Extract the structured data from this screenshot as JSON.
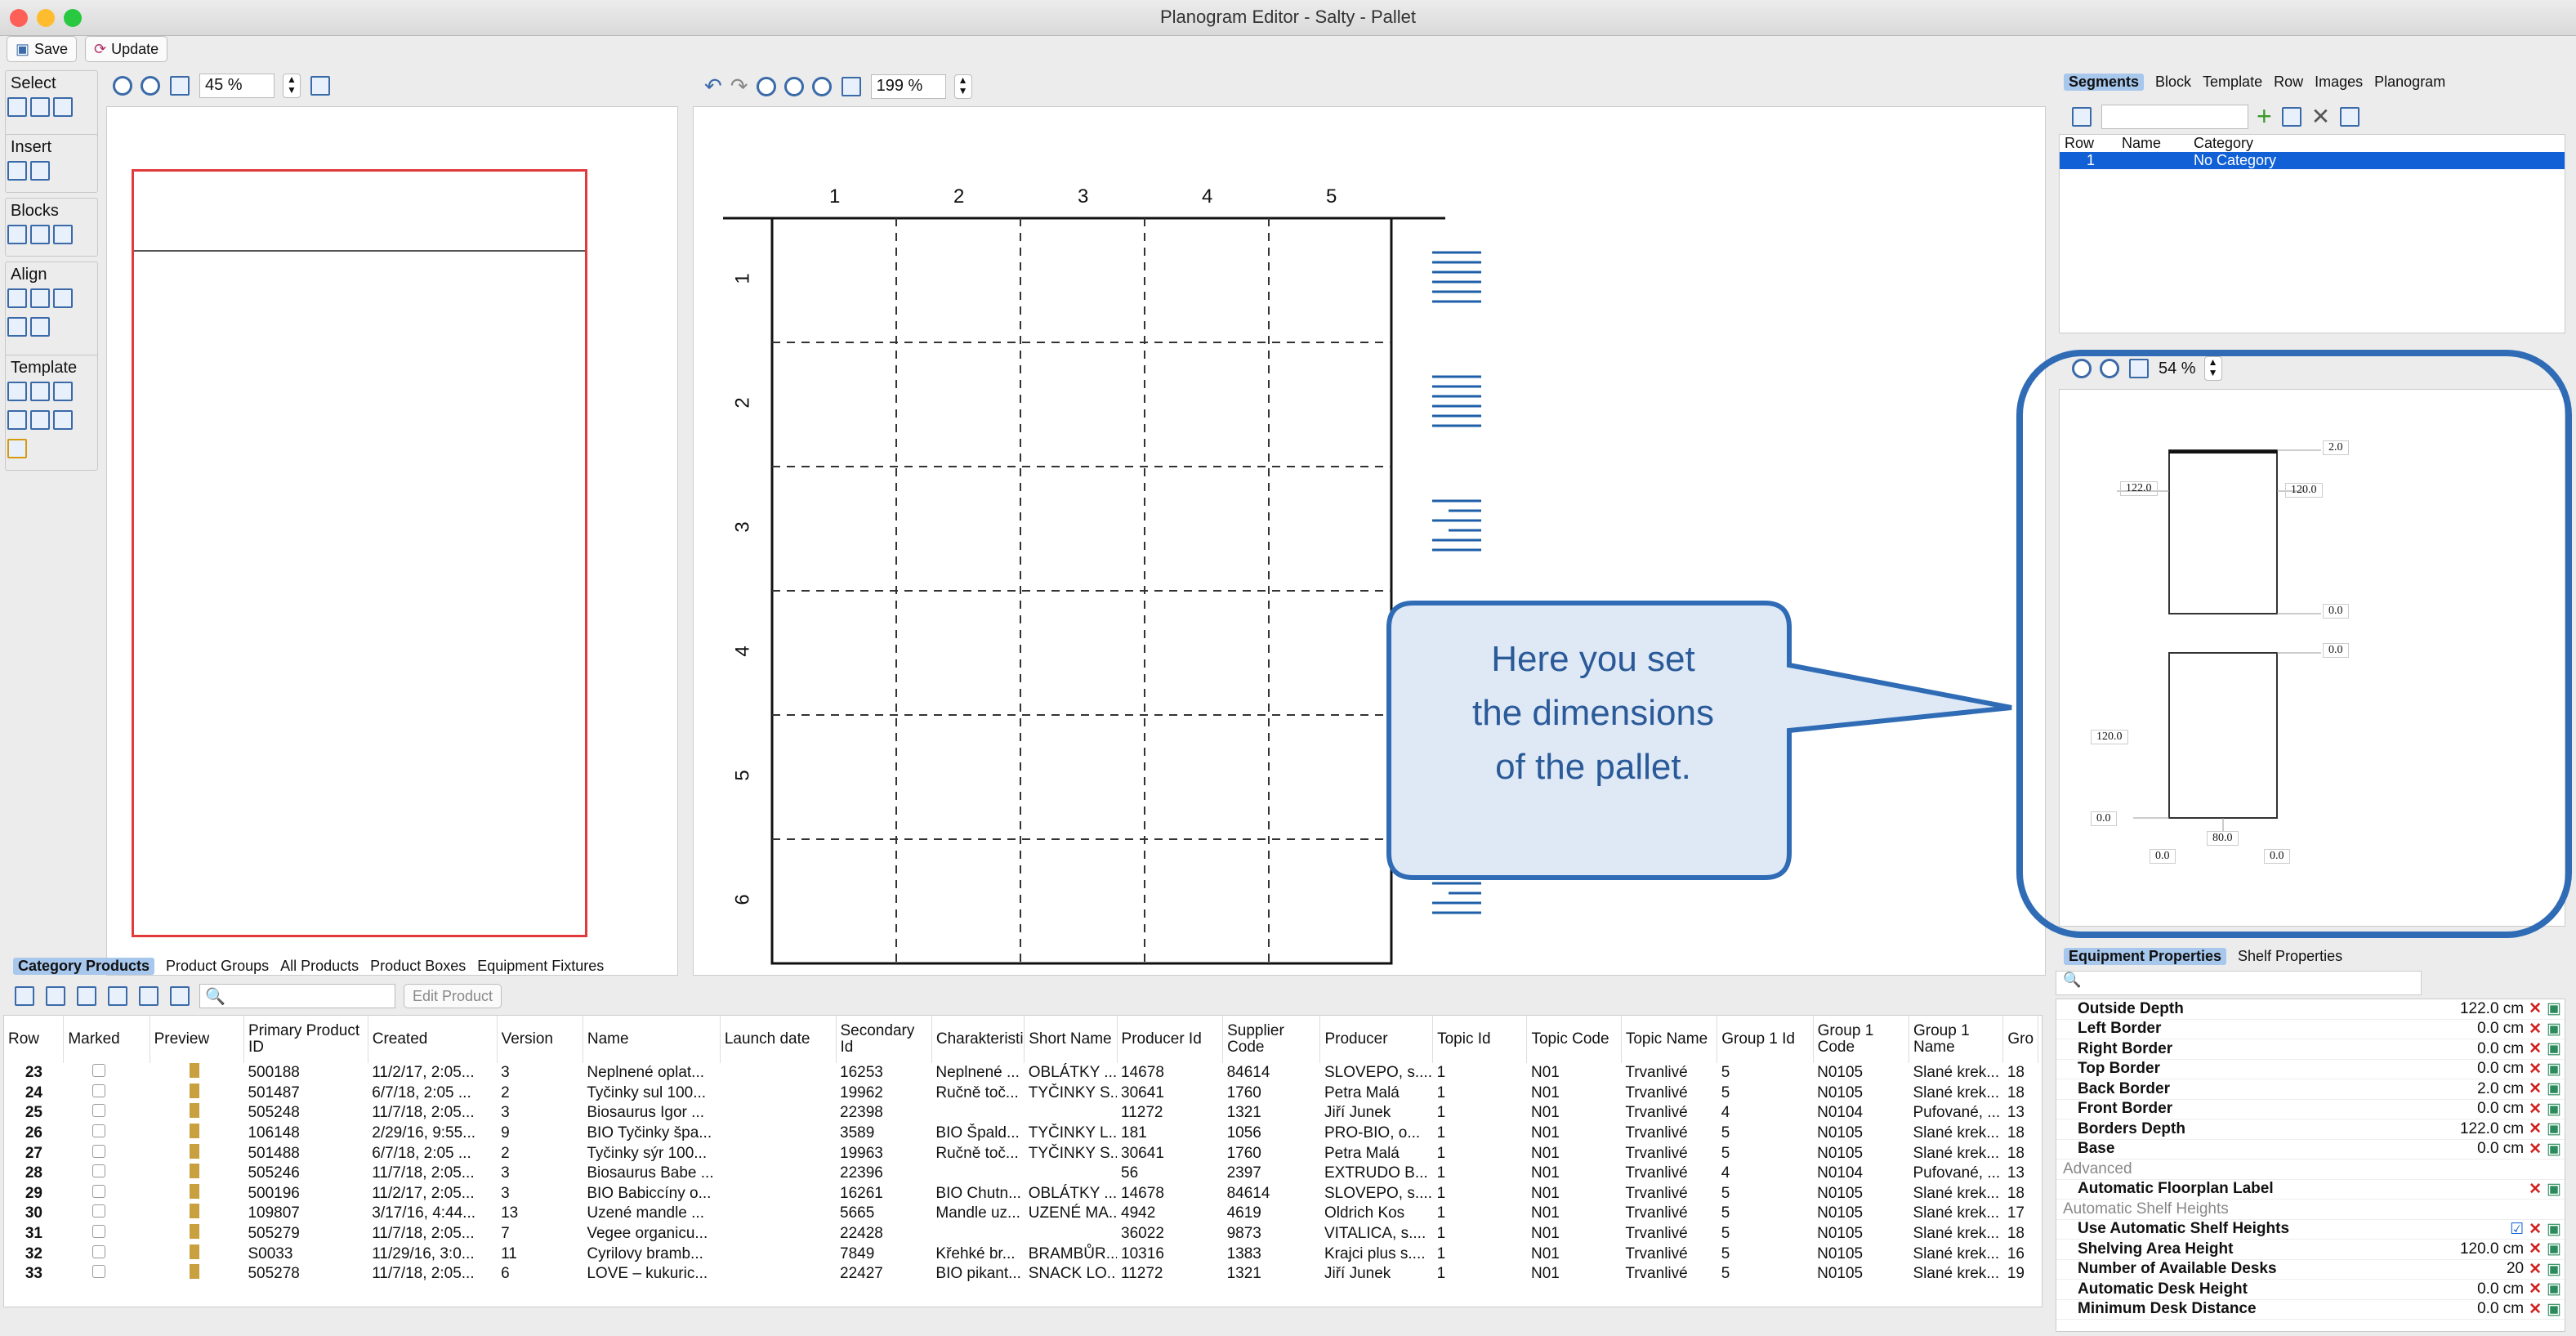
{
  "window": {
    "title": "Planogram Editor - Salty - Pallet"
  },
  "toolbar": {
    "save": "Save",
    "update": "Update"
  },
  "left": {
    "zoom": "45 %",
    "groups": {
      "select": "Select",
      "insert": "Insert",
      "blocks": "Blocks",
      "align": "Align",
      "template": "Template"
    }
  },
  "center": {
    "zoom": "199 %",
    "columns": [
      "1",
      "2",
      "3",
      "4",
      "5"
    ],
    "rows": [
      "1",
      "2",
      "3",
      "4",
      "5",
      "6"
    ]
  },
  "callout": {
    "line1": "Here you set",
    "line2": "the dimensions",
    "line3": "of the pallet."
  },
  "right": {
    "tabs": [
      "Segments",
      "Block",
      "Template",
      "Row",
      "Images",
      "Planogram"
    ],
    "seg_headers": [
      "Row",
      "Name",
      "Category"
    ],
    "seg_row": [
      "1",
      "",
      "No Category"
    ],
    "preview_zoom": "54 %",
    "dims": {
      "top": "2.0",
      "left_height": "122.0",
      "right_height": "120.0",
      "zero_a": "0.0",
      "zero_b": "0.0",
      "lower_height": "120.0",
      "bottom_left": "0.0",
      "width": "80.0",
      "bottom_a": "0.0",
      "bottom_b": "0.0"
    },
    "prop_tabs": [
      "Equipment Properties",
      "Shelf Properties"
    ],
    "props": [
      {
        "label": "Outside Depth",
        "value": "122.0 cm"
      },
      {
        "label": "Left Border",
        "value": "0.0 cm"
      },
      {
        "label": "Right Border",
        "value": "0.0 cm"
      },
      {
        "label": "Top Border",
        "value": "0.0 cm"
      },
      {
        "label": "Back Border",
        "value": "2.0 cm"
      },
      {
        "label": "Front Border",
        "value": "0.0 cm"
      },
      {
        "label": "Borders Depth",
        "value": "122.0 cm"
      },
      {
        "label": "Base",
        "value": "0.0 cm"
      }
    ],
    "advanced": "Advanced",
    "auto_floor": "Automatic Floorplan Label",
    "auto_shelf": "Automatic Shelf Heights",
    "props2": [
      {
        "label": "Use Automatic Shelf Heights",
        "value": "☑"
      },
      {
        "label": "Shelving Area Height",
        "value": "120.0 cm"
      },
      {
        "label": "Number of Available Desks",
        "value": "20"
      },
      {
        "label": "Automatic Desk Height",
        "value": "0.0 cm"
      },
      {
        "label": "Minimum Desk Distance",
        "value": "0.0 cm"
      }
    ]
  },
  "bottom": {
    "tabs": [
      "Category Products",
      "Product Groups",
      "All Products",
      "Product Boxes",
      "Equipment Fixtures"
    ],
    "edit_product": "Edit Product",
    "headers": [
      "Row",
      "Marked",
      "Preview",
      "Primary Product ID",
      "Created",
      "Version",
      "Name",
      "Launch date",
      "Secondary Id",
      "Charakteristika",
      "Short Name",
      "Producer Id",
      "Supplier Code",
      "Producer",
      "Topic Id",
      "Topic Code",
      "Topic Name",
      "Group 1 Id",
      "Group 1 Code",
      "Group 1 Name",
      "Gro"
    ],
    "rows": [
      [
        "23",
        "",
        "",
        "500188",
        "11/2/17, 2:05...",
        "3",
        "Neplnené oplat...",
        "",
        "16253",
        "Neplnené ...",
        "OBLÁTKY ...",
        "14678",
        "84614",
        "SLOVEPO, s....",
        "1",
        "N01",
        "Trvanlivé",
        "5",
        "N0105",
        "Slané krek...",
        "18"
      ],
      [
        "24",
        "",
        "",
        "501487",
        "6/7/18, 2:05 ...",
        "2",
        "Tyčinky sul 100...",
        "",
        "19962",
        "Ručně toč...",
        "TYČINKY S...",
        "30641",
        "1760",
        "Petra Malá",
        "1",
        "N01",
        "Trvanlivé",
        "5",
        "N0105",
        "Slané krek...",
        "18"
      ],
      [
        "25",
        "",
        "",
        "505248",
        "11/7/18, 2:05...",
        "3",
        "Biosaurus Igor ...",
        "",
        "22398",
        "",
        "",
        "11272",
        "1321",
        "Jiří Junek",
        "1",
        "N01",
        "Trvanlivé",
        "4",
        "N0104",
        "Pufované, ...",
        "13"
      ],
      [
        "26",
        "",
        "",
        "106148",
        "2/29/16, 9:55...",
        "9",
        "BIO Tyčinky špa...",
        "",
        "3589",
        "BIO Špald...",
        "TYČINKY L...",
        "181",
        "1056",
        "PRO-BIO, o...",
        "1",
        "N01",
        "Trvanlivé",
        "5",
        "N0105",
        "Slané krek...",
        "18"
      ],
      [
        "27",
        "",
        "",
        "501488",
        "6/7/18, 2:05 ...",
        "2",
        "Tyčinky sýr 100...",
        "",
        "19963",
        "Ručně toč...",
        "TYČINKY S...",
        "30641",
        "1760",
        "Petra Malá",
        "1",
        "N01",
        "Trvanlivé",
        "5",
        "N0105",
        "Slané krek...",
        "18"
      ],
      [
        "28",
        "",
        "",
        "505246",
        "11/7/18, 2:05...",
        "3",
        "Biosaurus Babe ...",
        "",
        "22396",
        "",
        "",
        "56",
        "2397",
        "EXTRUDO B...",
        "1",
        "N01",
        "Trvanlivé",
        "4",
        "N0104",
        "Pufované, ...",
        "13"
      ],
      [
        "29",
        "",
        "",
        "500196",
        "11/2/17, 2:05...",
        "3",
        "BIO Babiccíny o...",
        "",
        "16261",
        "BIO Chutn...",
        "OBLÁTKY ...",
        "14678",
        "84614",
        "SLOVEPO, s....",
        "1",
        "N01",
        "Trvanlivé",
        "5",
        "N0105",
        "Slané krek...",
        "18"
      ],
      [
        "30",
        "",
        "",
        "109807",
        "3/17/16, 4:44...",
        "13",
        "Uzené mandle ...",
        "",
        "5665",
        "Mandle uz...",
        "UZENÉ MA...",
        "4942",
        "4619",
        "Oldrich Kos",
        "1",
        "N01",
        "Trvanlivé",
        "5",
        "N0105",
        "Slané krek...",
        "17"
      ],
      [
        "31",
        "",
        "",
        "505279",
        "11/7/18, 2:05...",
        "7",
        "Vegee organicu...",
        "",
        "22428",
        "",
        "",
        "36022",
        "9873",
        "VITALICA, s....",
        "1",
        "N01",
        "Trvanlivé",
        "5",
        "N0105",
        "Slané krek...",
        "18"
      ],
      [
        "32",
        "",
        "",
        "S0033",
        "11/29/16, 3:0...",
        "11",
        "Cyrilovy bramb...",
        "",
        "7849",
        "Křehké br...",
        "BRAMBŮR...",
        "10316",
        "1383",
        "Krajci plus s....",
        "1",
        "N01",
        "Trvanlivé",
        "5",
        "N0105",
        "Slané krek...",
        "16"
      ],
      [
        "33",
        "",
        "",
        "505278",
        "11/7/18, 2:05...",
        "6",
        "LOVE – kukuric...",
        "",
        "22427",
        "BIO pikant...",
        "SNACK LO...",
        "11272",
        "1321",
        "Jiří Junek",
        "1",
        "N01",
        "Trvanlivé",
        "5",
        "N0105",
        "Slané krek...",
        "19"
      ]
    ]
  }
}
